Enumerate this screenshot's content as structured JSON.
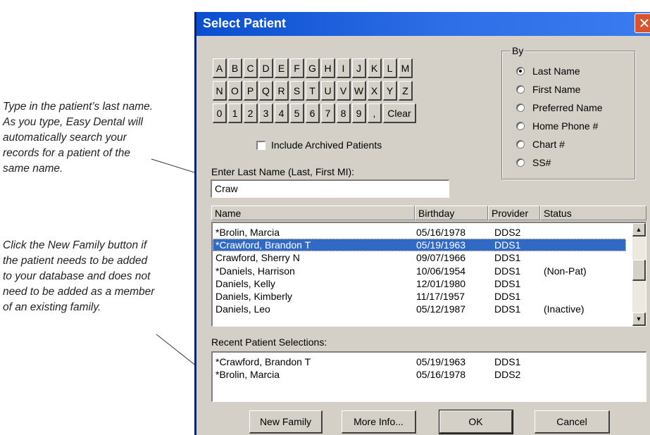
{
  "annotations": {
    "search_tip": "Type in the patient’s last name. As you type, Easy Dental will automatically search your records for a patient of the same name.",
    "new_family_tip": "Click the New Family button if the patient needs to be added to your database and does not need to be added as a member of an existing family."
  },
  "window": {
    "title": "Select Patient",
    "close_icon": "close-icon"
  },
  "keys": {
    "row1": [
      "A",
      "B",
      "C",
      "D",
      "E",
      "F",
      "G",
      "H",
      "I",
      "J",
      "K",
      "L",
      "M"
    ],
    "row2": [
      "N",
      "O",
      "P",
      "Q",
      "R",
      "S",
      "T",
      "U",
      "V",
      "W",
      "X",
      "Y",
      "Z"
    ],
    "row3": [
      "0",
      "1",
      "2",
      "3",
      "4",
      "5",
      "6",
      "7",
      "8",
      "9",
      ","
    ],
    "clear_label": "Clear"
  },
  "include_archived": {
    "label": "Include Archived Patients",
    "checked": false
  },
  "by_group": {
    "legend": "By",
    "options": [
      "Last Name",
      "First Name",
      "Preferred Name",
      "Home Phone #",
      "Chart #",
      "SS#"
    ],
    "selected": "Last Name"
  },
  "search": {
    "label": "Enter Last Name (Last, First MI):",
    "value": "Craw"
  },
  "columns": {
    "name": "Name",
    "birthday": "Birthday",
    "provider": "Provider",
    "status": "Status"
  },
  "patients": [
    {
      "name": "*Brolin, Marcia",
      "birthday": "05/16/1978",
      "provider": "DDS2",
      "status": ""
    },
    {
      "name": "*Crawford, Brandon T",
      "birthday": "05/19/1963",
      "provider": "DDS1",
      "status": "",
      "selected": true
    },
    {
      "name": " Crawford, Sherry N",
      "birthday": "09/07/1966",
      "provider": "DDS1",
      "status": ""
    },
    {
      "name": "*Daniels, Harrison",
      "birthday": "10/06/1954",
      "provider": "DDS1",
      "status": "(Non-Pat)"
    },
    {
      "name": " Daniels, Kelly",
      "birthday": "12/01/1980",
      "provider": "DDS1",
      "status": ""
    },
    {
      "name": " Daniels, Kimberly",
      "birthday": "11/17/1957",
      "provider": "DDS1",
      "status": ""
    },
    {
      "name": " Daniels, Leo",
      "birthday": "05/12/1987",
      "provider": "DDS1",
      "status": "(Inactive)"
    }
  ],
  "recent": {
    "label": "Recent Patient Selections:",
    "items": [
      {
        "name": "*Crawford, Brandon T",
        "birthday": "05/19/1963",
        "provider": "DDS1"
      },
      {
        "name": "*Brolin, Marcia",
        "birthday": "05/16/1978",
        "provider": "DDS2"
      }
    ]
  },
  "buttons": {
    "new_family": "New Family",
    "more_info": "More Info...",
    "ok": "OK",
    "cancel": "Cancel"
  }
}
